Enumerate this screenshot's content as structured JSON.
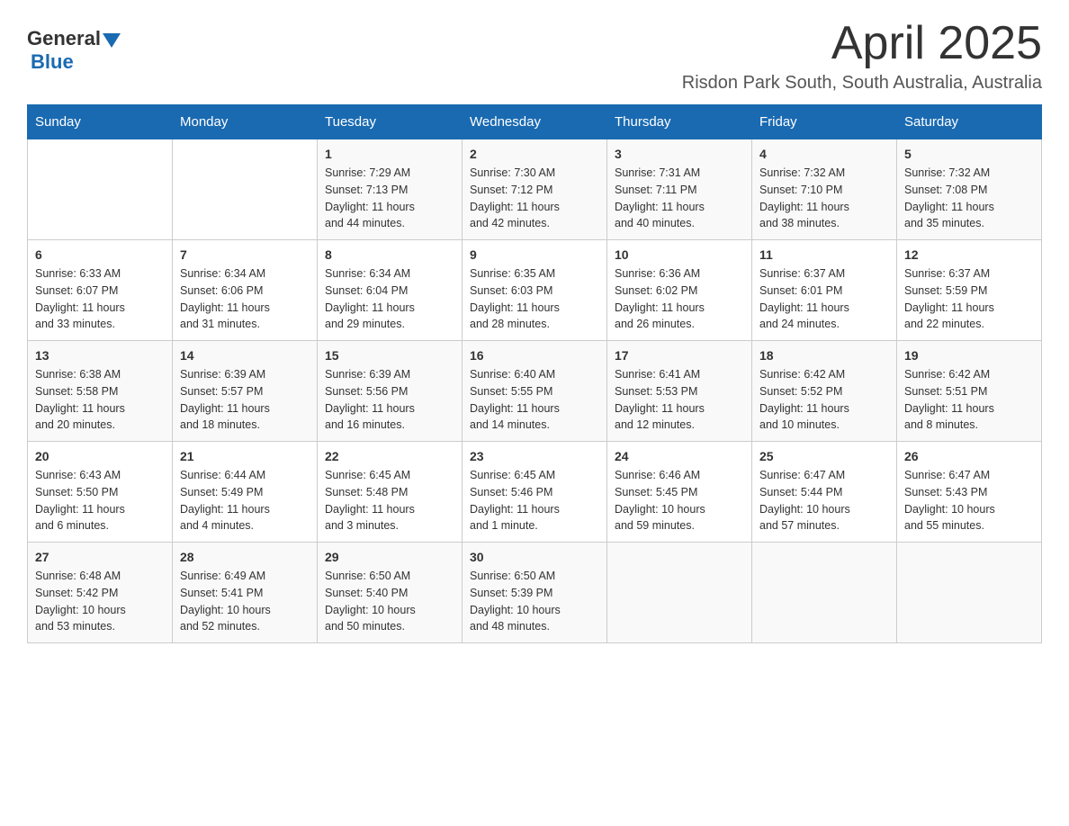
{
  "logo": {
    "text_general": "General",
    "text_blue": "Blue",
    "triangle_color": "#1a6ab1"
  },
  "header": {
    "month_title": "April 2025",
    "location": "Risdon Park South, South Australia, Australia"
  },
  "days_of_week": [
    "Sunday",
    "Monday",
    "Tuesday",
    "Wednesday",
    "Thursday",
    "Friday",
    "Saturday"
  ],
  "weeks": [
    [
      {
        "day": "",
        "info": ""
      },
      {
        "day": "",
        "info": ""
      },
      {
        "day": "1",
        "info": "Sunrise: 7:29 AM\nSunset: 7:13 PM\nDaylight: 11 hours\nand 44 minutes."
      },
      {
        "day": "2",
        "info": "Sunrise: 7:30 AM\nSunset: 7:12 PM\nDaylight: 11 hours\nand 42 minutes."
      },
      {
        "day": "3",
        "info": "Sunrise: 7:31 AM\nSunset: 7:11 PM\nDaylight: 11 hours\nand 40 minutes."
      },
      {
        "day": "4",
        "info": "Sunrise: 7:32 AM\nSunset: 7:10 PM\nDaylight: 11 hours\nand 38 minutes."
      },
      {
        "day": "5",
        "info": "Sunrise: 7:32 AM\nSunset: 7:08 PM\nDaylight: 11 hours\nand 35 minutes."
      }
    ],
    [
      {
        "day": "6",
        "info": "Sunrise: 6:33 AM\nSunset: 6:07 PM\nDaylight: 11 hours\nand 33 minutes."
      },
      {
        "day": "7",
        "info": "Sunrise: 6:34 AM\nSunset: 6:06 PM\nDaylight: 11 hours\nand 31 minutes."
      },
      {
        "day": "8",
        "info": "Sunrise: 6:34 AM\nSunset: 6:04 PM\nDaylight: 11 hours\nand 29 minutes."
      },
      {
        "day": "9",
        "info": "Sunrise: 6:35 AM\nSunset: 6:03 PM\nDaylight: 11 hours\nand 28 minutes."
      },
      {
        "day": "10",
        "info": "Sunrise: 6:36 AM\nSunset: 6:02 PM\nDaylight: 11 hours\nand 26 minutes."
      },
      {
        "day": "11",
        "info": "Sunrise: 6:37 AM\nSunset: 6:01 PM\nDaylight: 11 hours\nand 24 minutes."
      },
      {
        "day": "12",
        "info": "Sunrise: 6:37 AM\nSunset: 5:59 PM\nDaylight: 11 hours\nand 22 minutes."
      }
    ],
    [
      {
        "day": "13",
        "info": "Sunrise: 6:38 AM\nSunset: 5:58 PM\nDaylight: 11 hours\nand 20 minutes."
      },
      {
        "day": "14",
        "info": "Sunrise: 6:39 AM\nSunset: 5:57 PM\nDaylight: 11 hours\nand 18 minutes."
      },
      {
        "day": "15",
        "info": "Sunrise: 6:39 AM\nSunset: 5:56 PM\nDaylight: 11 hours\nand 16 minutes."
      },
      {
        "day": "16",
        "info": "Sunrise: 6:40 AM\nSunset: 5:55 PM\nDaylight: 11 hours\nand 14 minutes."
      },
      {
        "day": "17",
        "info": "Sunrise: 6:41 AM\nSunset: 5:53 PM\nDaylight: 11 hours\nand 12 minutes."
      },
      {
        "day": "18",
        "info": "Sunrise: 6:42 AM\nSunset: 5:52 PM\nDaylight: 11 hours\nand 10 minutes."
      },
      {
        "day": "19",
        "info": "Sunrise: 6:42 AM\nSunset: 5:51 PM\nDaylight: 11 hours\nand 8 minutes."
      }
    ],
    [
      {
        "day": "20",
        "info": "Sunrise: 6:43 AM\nSunset: 5:50 PM\nDaylight: 11 hours\nand 6 minutes."
      },
      {
        "day": "21",
        "info": "Sunrise: 6:44 AM\nSunset: 5:49 PM\nDaylight: 11 hours\nand 4 minutes."
      },
      {
        "day": "22",
        "info": "Sunrise: 6:45 AM\nSunset: 5:48 PM\nDaylight: 11 hours\nand 3 minutes."
      },
      {
        "day": "23",
        "info": "Sunrise: 6:45 AM\nSunset: 5:46 PM\nDaylight: 11 hours\nand 1 minute."
      },
      {
        "day": "24",
        "info": "Sunrise: 6:46 AM\nSunset: 5:45 PM\nDaylight: 10 hours\nand 59 minutes."
      },
      {
        "day": "25",
        "info": "Sunrise: 6:47 AM\nSunset: 5:44 PM\nDaylight: 10 hours\nand 57 minutes."
      },
      {
        "day": "26",
        "info": "Sunrise: 6:47 AM\nSunset: 5:43 PM\nDaylight: 10 hours\nand 55 minutes."
      }
    ],
    [
      {
        "day": "27",
        "info": "Sunrise: 6:48 AM\nSunset: 5:42 PM\nDaylight: 10 hours\nand 53 minutes."
      },
      {
        "day": "28",
        "info": "Sunrise: 6:49 AM\nSunset: 5:41 PM\nDaylight: 10 hours\nand 52 minutes."
      },
      {
        "day": "29",
        "info": "Sunrise: 6:50 AM\nSunset: 5:40 PM\nDaylight: 10 hours\nand 50 minutes."
      },
      {
        "day": "30",
        "info": "Sunrise: 6:50 AM\nSunset: 5:39 PM\nDaylight: 10 hours\nand 48 minutes."
      },
      {
        "day": "",
        "info": ""
      },
      {
        "day": "",
        "info": ""
      },
      {
        "day": "",
        "info": ""
      }
    ]
  ]
}
